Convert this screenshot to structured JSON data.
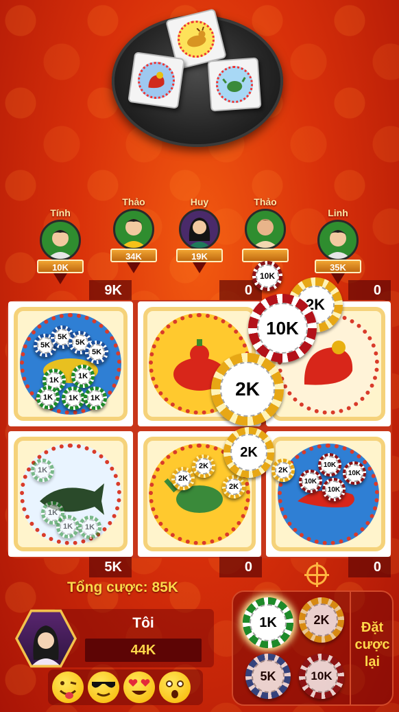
{
  "players": [
    {
      "name": "Tính",
      "balance": "10K"
    },
    {
      "name": "Thảo",
      "balance": "34K"
    },
    {
      "name": "Huy",
      "balance": "19K"
    },
    {
      "name": "Thảo",
      "balance": ""
    },
    {
      "name": "Linh",
      "balance": "35K"
    }
  ],
  "top_bets": [
    "9K",
    "0",
    "0"
  ],
  "bottom_bets": [
    "5K",
    "0",
    "0"
  ],
  "cells": [
    {
      "animal": "fish",
      "symbol": "deer-icon"
    },
    {
      "animal": "gourd",
      "symbol": "gourd-icon"
    },
    {
      "animal": "rooster",
      "symbol": "rooster-icon"
    },
    {
      "animal": "fish",
      "symbol": "fish-icon"
    },
    {
      "animal": "crab",
      "symbol": "crab-icon"
    },
    {
      "animal": "shrimp",
      "symbol": "shrimp-icon"
    }
  ],
  "chip_labels": {
    "k1": "1K",
    "k2": "2K",
    "k5": "5K",
    "k10": "10K"
  },
  "total_label": "Tổng cược: 85K",
  "me": {
    "name": "Tôi",
    "balance": "44K"
  },
  "selector": {
    "chips": [
      "1K",
      "2K",
      "5K",
      "10K"
    ],
    "rebet_line1": "Đặt",
    "rebet_line2": "cược",
    "rebet_line3": "lại"
  },
  "emojis": [
    "tongue-emoji",
    "sunglasses-emoji",
    "heart-eyes-emoji",
    "surprised-emoji"
  ],
  "colors": {
    "background": "#d8300a",
    "accent": "#ffd84a",
    "board": "#c8361a"
  }
}
